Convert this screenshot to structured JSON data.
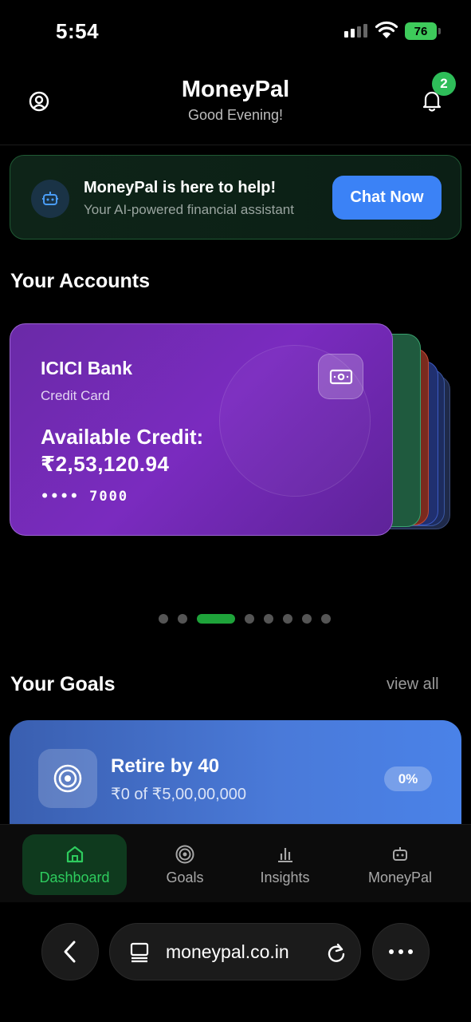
{
  "status_bar": {
    "time": "5:54",
    "battery": "76"
  },
  "header": {
    "title": "MoneyPal",
    "greeting": "Good Evening!",
    "notification_count": "2"
  },
  "assistant_banner": {
    "title": "MoneyPal is here to help!",
    "subtitle": "Your AI-powered financial assistant",
    "cta": "Chat Now"
  },
  "accounts": {
    "section_title": "Your Accounts",
    "active_card": {
      "bank": "ICICI Bank",
      "type": "Credit Card",
      "balance_label": "Available Credit:",
      "balance": "₹2,53,120.94",
      "masked_number": "•••• 7000"
    },
    "page_count": 8,
    "active_page": 3
  },
  "goals": {
    "section_title": "Your Goals",
    "view_all": "view all",
    "items": [
      {
        "title": "Retire by 40",
        "progress_text": "₹0 of ₹5,00,00,000",
        "percent": "0%"
      }
    ]
  },
  "bottom_nav": {
    "items": [
      {
        "label": "Dashboard",
        "icon": "home-icon",
        "active": true
      },
      {
        "label": "Goals",
        "icon": "target-icon",
        "active": false
      },
      {
        "label": "Insights",
        "icon": "bar-chart-icon",
        "active": false
      },
      {
        "label": "MoneyPal",
        "icon": "robot-icon",
        "active": false
      }
    ]
  },
  "browser": {
    "url": "moneypal.co.in"
  },
  "colors": {
    "accent_green": "#2ecc5e",
    "card_purple": "#6a2aa7",
    "primary_blue": "#3b82f6",
    "goal_blue": "#4a7ad9"
  }
}
